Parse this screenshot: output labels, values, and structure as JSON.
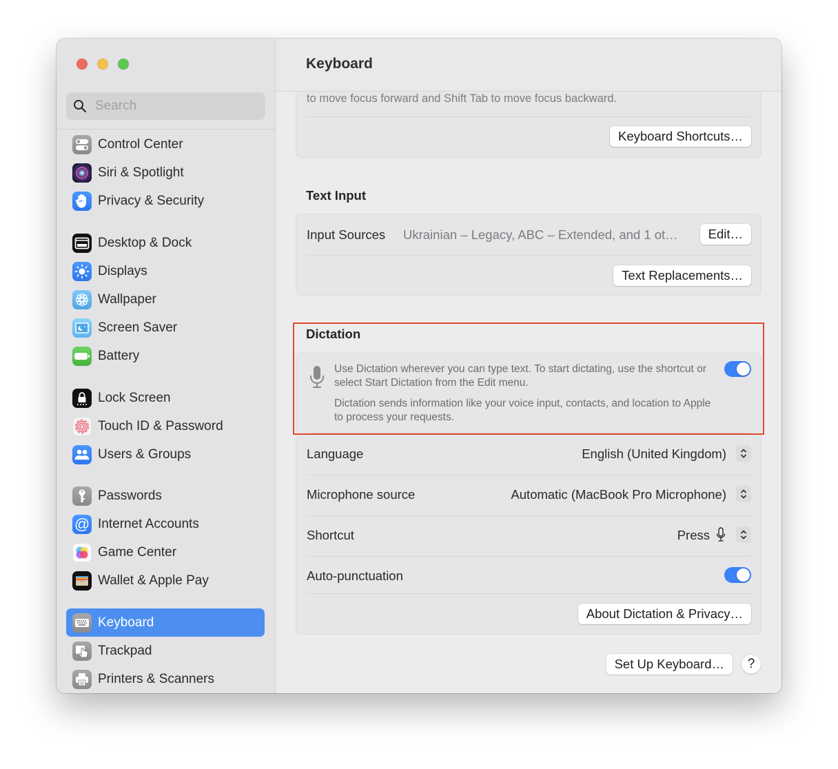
{
  "window": {
    "title": "Keyboard",
    "traffic_lights": [
      "close",
      "minimize",
      "maximize"
    ]
  },
  "sidebar": {
    "search": {
      "placeholder": "Search",
      "value": ""
    },
    "items": [
      {
        "label": "Control Center",
        "icon": "control-center-icon"
      },
      {
        "label": "Siri & Spotlight",
        "icon": "siri-icon"
      },
      {
        "label": "Privacy & Security",
        "icon": "hand-icon"
      },
      {
        "label": "Desktop & Dock",
        "icon": "dock-icon"
      },
      {
        "label": "Displays",
        "icon": "sun-icon"
      },
      {
        "label": "Wallpaper",
        "icon": "flower-icon"
      },
      {
        "label": "Screen Saver",
        "icon": "screen-saver-icon"
      },
      {
        "label": "Battery",
        "icon": "battery-icon"
      },
      {
        "label": "Lock Screen",
        "icon": "lock-icon"
      },
      {
        "label": "Touch ID & Password",
        "icon": "fingerprint-icon"
      },
      {
        "label": "Users & Groups",
        "icon": "users-icon"
      },
      {
        "label": "Passwords",
        "icon": "key-icon"
      },
      {
        "label": "Internet Accounts",
        "icon": "at-icon"
      },
      {
        "label": "Game Center",
        "icon": "game-center-icon"
      },
      {
        "label": "Wallet & Apple Pay",
        "icon": "wallet-icon"
      },
      {
        "label": "Keyboard",
        "icon": "keyboard-icon",
        "selected": true
      },
      {
        "label": "Trackpad",
        "icon": "trackpad-icon"
      },
      {
        "label": "Printers & Scanners",
        "icon": "printer-icon"
      }
    ]
  },
  "main": {
    "header": "Keyboard",
    "keyboard_nav": {
      "text": "to move focus forward and Shift Tab to move focus backward.",
      "shortcuts_button": "Keyboard Shortcuts…"
    },
    "text_input": {
      "title": "Text Input",
      "input_sources_label": "Input Sources",
      "input_sources_value": "Ukrainian – Legacy, ABC – Extended, and 1 ot…",
      "edit_button": "Edit…",
      "text_replacements_button": "Text Replacements…"
    },
    "dictation": {
      "title": "Dictation",
      "description": "Use Dictation wherever you can type text. To start dictating, use the shortcut or select Start Dictation from the Edit menu.",
      "privacy_note": "Dictation sends information like your voice input, contacts, and location to Apple to process your requests.",
      "enabled": true,
      "language_label": "Language",
      "language_value": "English (United Kingdom)",
      "mic_label": "Microphone source",
      "mic_value": "Automatic (MacBook Pro Microphone)",
      "shortcut_label": "Shortcut",
      "shortcut_value": "Press",
      "shortcut_key_icon": "microphone-icon",
      "autopunct_label": "Auto-punctuation",
      "autopunct_enabled": true,
      "about_button": "About Dictation & Privacy…"
    },
    "footer": {
      "setup_button": "Set Up Keyboard…",
      "help_button": "?"
    },
    "highlight_color": "#e0492f",
    "accent_color": "#3a82f7"
  }
}
